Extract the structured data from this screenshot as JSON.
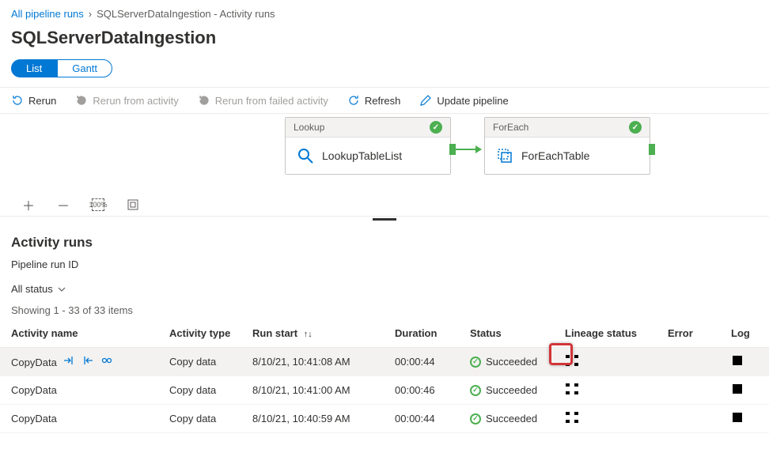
{
  "breadcrumb": {
    "root": "All pipeline runs",
    "current": "SQLServerDataIngestion - Activity runs"
  },
  "pageTitle": "SQLServerDataIngestion",
  "viewToggle": {
    "list": "List",
    "gantt": "Gantt"
  },
  "toolbar": {
    "rerun": "Rerun",
    "rerunActivity": "Rerun from activity",
    "rerunFailed": "Rerun from failed activity",
    "refresh": "Refresh",
    "updatePipeline": "Update pipeline"
  },
  "canvas": {
    "lookup": {
      "type": "Lookup",
      "name": "LookupTableList"
    },
    "foreach": {
      "type": "ForEach",
      "name": "ForEachTable"
    }
  },
  "section": {
    "title": "Activity runs",
    "runIdLabel": "Pipeline run ID",
    "statusFilter": "All status",
    "showing": "Showing 1 - 33 of 33 items"
  },
  "columns": {
    "activityName": "Activity name",
    "activityType": "Activity type",
    "runStart": "Run start",
    "duration": "Duration",
    "status": "Status",
    "lineage": "Lineage status",
    "error": "Error",
    "log": "Log"
  },
  "rows": [
    {
      "name": "CopyData",
      "type": "Copy data",
      "start": "8/10/21, 10:41:08 AM",
      "duration": "00:00:44",
      "status": "Succeeded"
    },
    {
      "name": "CopyData",
      "type": "Copy data",
      "start": "8/10/21, 10:41:00 AM",
      "duration": "00:00:46",
      "status": "Succeeded"
    },
    {
      "name": "CopyData",
      "type": "Copy data",
      "start": "8/10/21, 10:40:59 AM",
      "duration": "00:00:44",
      "status": "Succeeded"
    }
  ]
}
